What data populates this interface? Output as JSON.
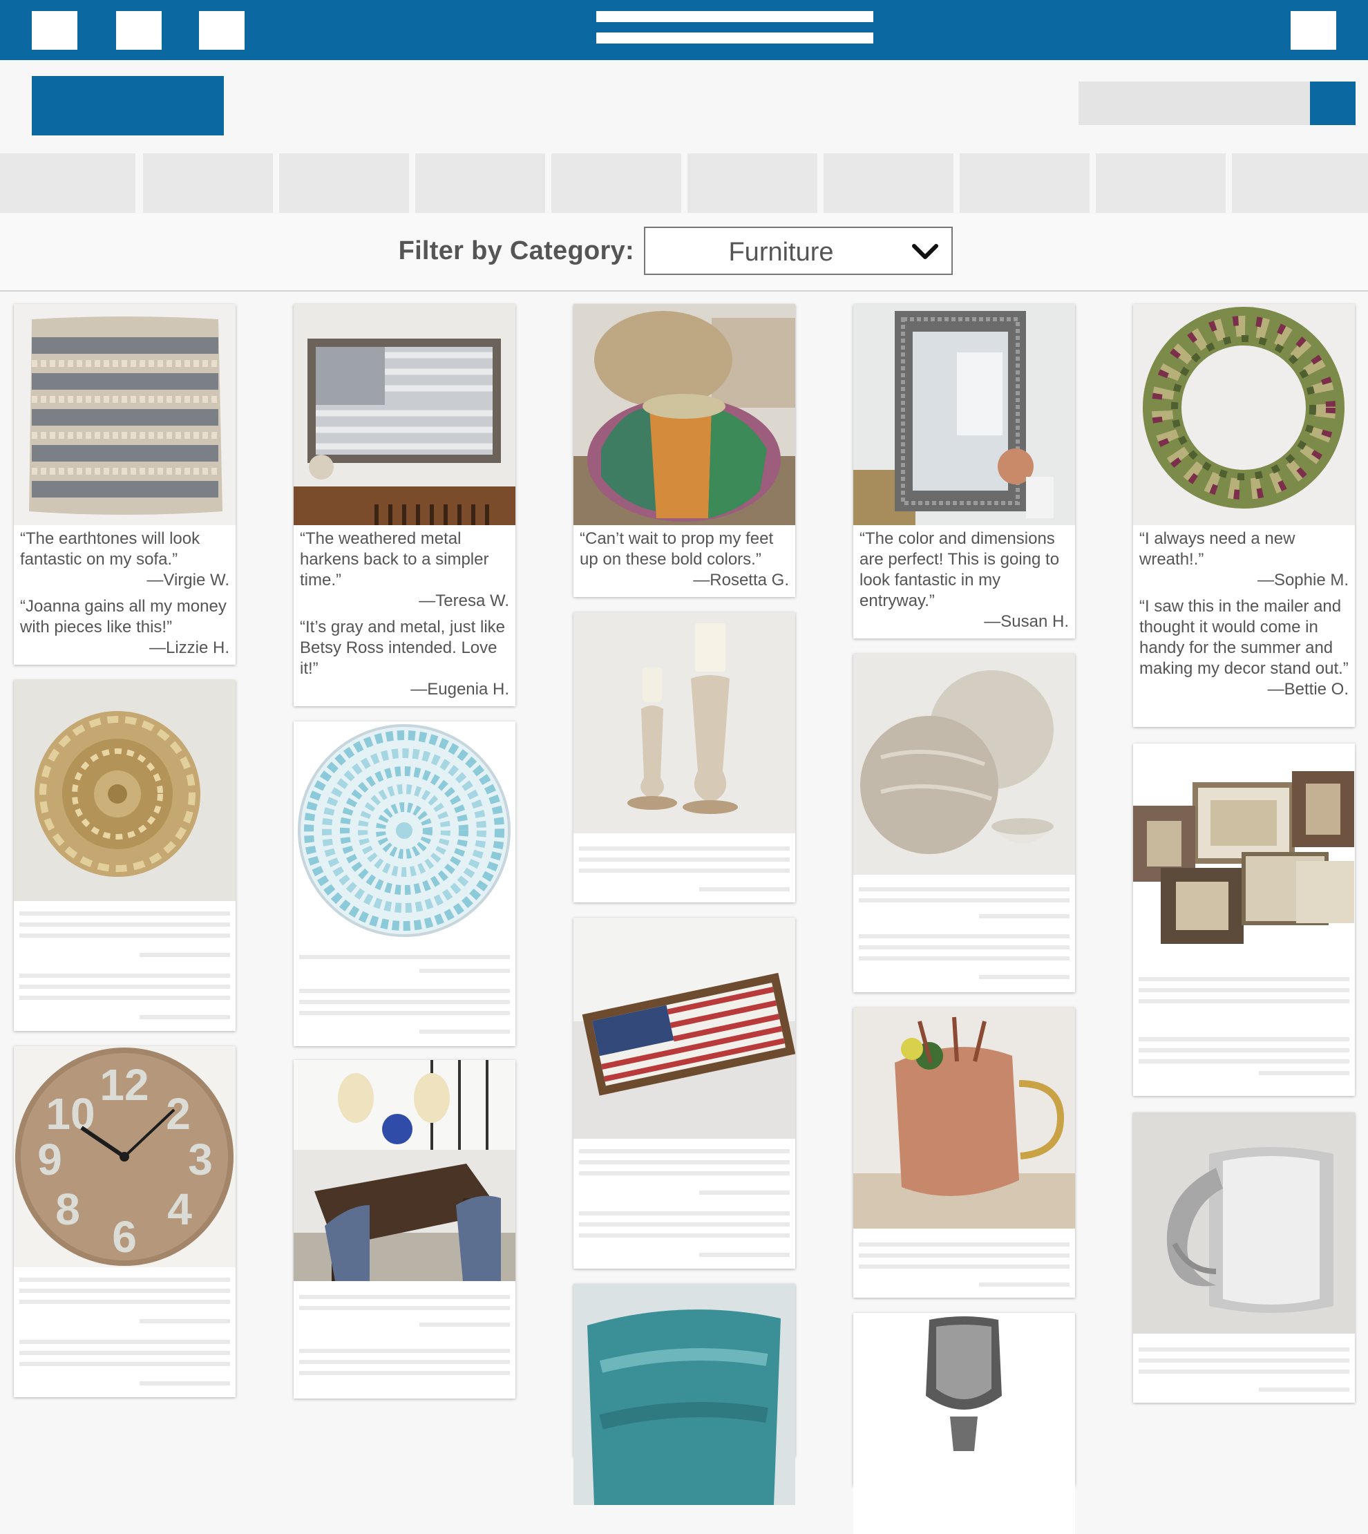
{
  "filter": {
    "label": "Filter by Category:",
    "value": "Furniture"
  },
  "reviews": [
    {
      "quote": "“The earthtones will look fantastic on my sofa.”",
      "author": "—Virgie  W."
    },
    {
      "quote": "“Joanna gains all my money with pieces like this!”",
      "author": "—Lizzie H."
    },
    {
      "quote": "“The weathered metal harkens back to a simpler time.”",
      "author": "—Teresa W."
    },
    {
      "quote": "“It’s gray and metal, just like Betsy Ross intended. Love it!”",
      "author": "—Eugenia H."
    },
    {
      "quote": "“Can’t wait to prop my feet up on these bold colors.”",
      "author": "—Rosetta G."
    },
    {
      "quote": "“The color and dimensions are perfect! This is going to look fantastic in my entryway.”",
      "author": "—Susan H."
    },
    {
      "quote": "“I always need a new wreath!.”",
      "author": "—Sophie M."
    },
    {
      "quote": "“I saw this in the mailer and thought it would come in handy for the summer and making my decor stand out.”",
      "author": "—Bettie O."
    }
  ],
  "colors": {
    "brand": "#0b68a0",
    "placeholder": "#e8e8e8"
  },
  "icons": {
    "filter_dropdown": "chevron-down-icon"
  }
}
